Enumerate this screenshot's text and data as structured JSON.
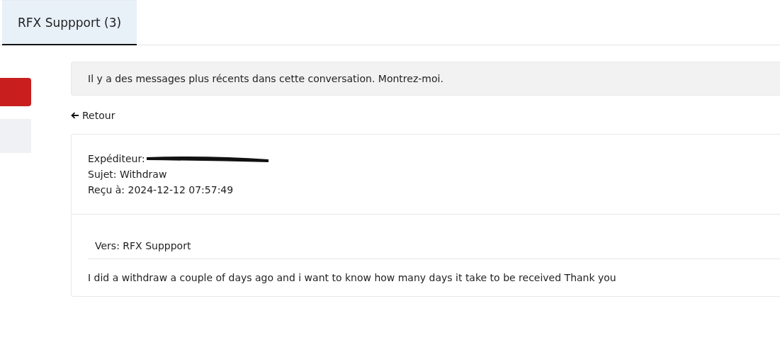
{
  "tabs": [
    {
      "label": "RFX Suppport (3)",
      "selected": true
    }
  ],
  "notice": "Il y a des messages plus récents dans cette conversation. Montrez-moi.",
  "back_link": "Retour",
  "message": {
    "sender_label": "Expéditeur:",
    "subject": "Sujet: Withdraw",
    "received": "Reçu à: 2024-12-12 07:57:49",
    "to": "Vers: RFX Suppport",
    "body": "I did a withdraw a couple of days ago and i want to know how many days it take to be received Thank you"
  }
}
